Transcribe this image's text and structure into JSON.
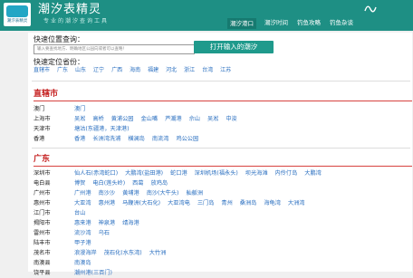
{
  "header": {
    "logo_text": "潮汐表精灵",
    "title": "潮汐表精灵",
    "slogan": "专业的潮汐查询工具",
    "nav": [
      "潮汐港口",
      "潮汐时间",
      "钓鱼攻略",
      "钓鱼杂谈"
    ]
  },
  "search": {
    "title": "快速位置查询：",
    "placeholder": "输入要查找地方、明确地区公园向或者可以查略！",
    "button": "打开输入的潮汐"
  },
  "provinces": {
    "title": "快速定位省份：",
    "items": [
      "直辖市",
      "广东",
      "山东",
      "辽宁",
      "广西",
      "海南",
      "福建",
      "河北",
      "浙江",
      "台湾",
      "江苏"
    ]
  },
  "regions": [
    {
      "title": "直辖市",
      "rows": [
        {
          "city": "澳门",
          "ports": [
            "澳门"
          ]
        },
        {
          "city": "上海市",
          "ports": [
            "吴淞",
            "高桥",
            "黄浦公园",
            "金山嘴",
            "芦潮港",
            "佘山",
            "吴淞",
            "中浚"
          ]
        },
        {
          "city": "天津市",
          "ports": [
            "塘沽(东疆港，天津港)"
          ]
        },
        {
          "city": "香港",
          "ports": [
            "香港",
            "长洲湾洗浦",
            "横澜岛",
            "南流湾",
            "鸡公公园"
          ]
        }
      ]
    },
    {
      "title": "广东",
      "rows": [
        {
          "city": "深圳市",
          "ports": [
            "仙人石(赤湾蛇口)",
            "大鹏湾(盐田港)",
            "蛇口港",
            "深圳机场(福永头)",
            "坝光海滩",
            "内伶仃岛",
            "大鹏湾"
          ]
        },
        {
          "city": "电白县",
          "ports": [
            "博贺",
            "电白(莲头岭)",
            "西葛",
            "放鸡岛"
          ]
        },
        {
          "city": "广州市",
          "ports": [
            "广州港",
            "南沙沙",
            "黄埔港",
            "南沙(大牛头)",
            "舢舨洲"
          ]
        },
        {
          "city": "惠州市",
          "ports": [
            "大亚湾",
            "惠州港",
            "马鞭洲(大石化)",
            "大亚湾电",
            "三门岛",
            "青州",
            "桑洲岛",
            "海龟湾",
            "大洲湾"
          ]
        },
        {
          "city": "江门市",
          "ports": [
            "台山"
          ]
        },
        {
          "city": "揭阳市",
          "ports": [
            "惠来港",
            "神泉港",
            "靖海港"
          ]
        },
        {
          "city": "雷州市",
          "ports": [
            "流沙湾",
            "乌石"
          ]
        },
        {
          "city": "陆丰市",
          "ports": [
            "甲子港"
          ]
        },
        {
          "city": "茂名市",
          "ports": [
            "浪漫海岸",
            "茂石化(水东湾)",
            "大竹洲"
          ]
        },
        {
          "city": "南澳县",
          "ports": [
            "南澳岛"
          ]
        },
        {
          "city": "饶平县",
          "ports": [
            "潮州港(三百门)"
          ]
        }
      ]
    }
  ],
  "colors": {
    "header": "#1e8f84",
    "link": "#2a6fc0",
    "region": "#c62424"
  }
}
